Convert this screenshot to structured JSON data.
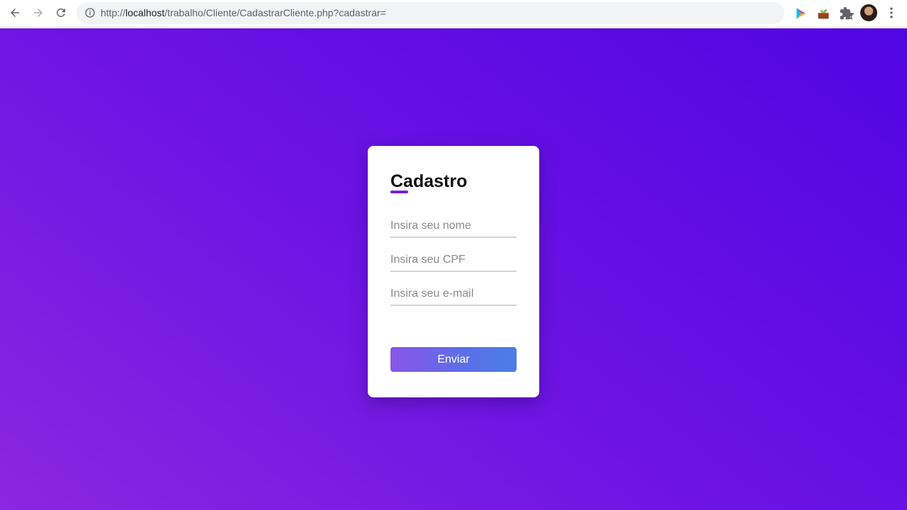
{
  "browser": {
    "url_prefix": "http://",
    "url_host": "localhost",
    "url_path": "/trabalho/Cliente/CadastrarCliente.php?cadastrar=",
    "icons": {
      "back": "arrow-left-icon",
      "forward": "arrow-right-icon",
      "reload": "reload-icon",
      "info": "info-icon",
      "bookmark": "star-icon",
      "extensions": [
        "play-extension-icon",
        "plant-extension-icon",
        "puzzle-icon"
      ],
      "menu": "kebab-menu-icon"
    }
  },
  "form": {
    "title": "Cadastro",
    "fields": [
      {
        "name": "nome",
        "placeholder": "Insira seu nome",
        "value": ""
      },
      {
        "name": "cpf",
        "placeholder": "Insira seu CPF",
        "value": ""
      },
      {
        "name": "email",
        "placeholder": "Insira seu e-mail",
        "value": ""
      }
    ],
    "submit_label": "Enviar"
  },
  "colors": {
    "background_start": "#8a27e0",
    "background_end": "#5105e3",
    "accent": "#7a1fe0",
    "button_start": "#8955e8",
    "button_end": "#4a7ee6"
  }
}
